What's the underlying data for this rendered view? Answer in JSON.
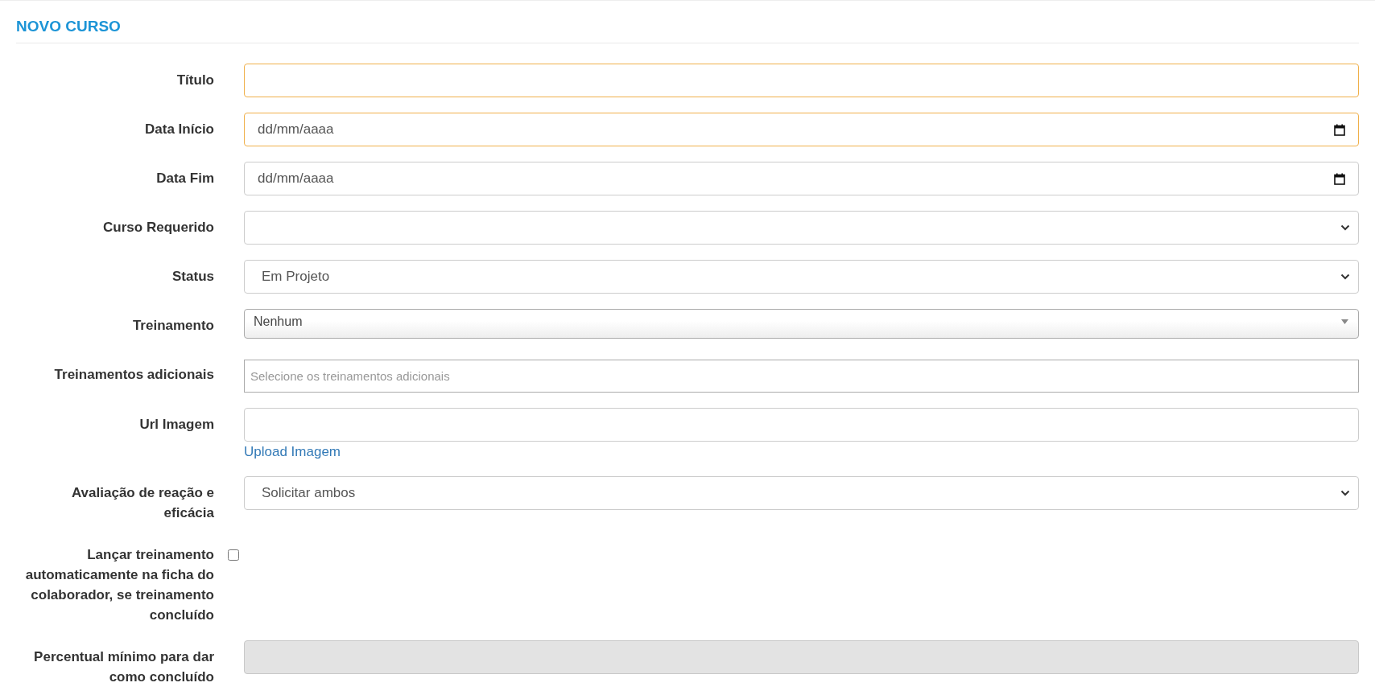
{
  "heading": "NOVO CURSO",
  "fields": [
    {
      "label": "Título",
      "kind": "text",
      "highlighted": true,
      "disabled": false
    },
    {
      "label": "Data Início",
      "kind": "date",
      "placeholder": "dd/mm/aaaa",
      "highlighted": true,
      "disabled": false
    },
    {
      "label": "Data Fim",
      "kind": "date",
      "placeholder": "dd/mm/aaaa",
      "highlighted": false,
      "disabled": false
    },
    {
      "label": "Curso Requerido",
      "kind": "select",
      "highlighted": false,
      "disabled": false
    },
    {
      "label": "Status",
      "kind": "select",
      "value": "Em Projeto",
      "highlighted": false,
      "disabled": false
    },
    {
      "label": "Treinamento",
      "kind": "combo",
      "value": "Nenhum",
      "highlighted": false,
      "disabled": false
    },
    {
      "label": "Treinamentos adicionais",
      "kind": "multi",
      "placeholder": "Selecione os treinamentos adicionais",
      "highlighted": false,
      "disabled": false
    },
    {
      "label": "Url Imagem",
      "kind": "text",
      "link": "Upload Imagem",
      "highlighted": false,
      "disabled": false
    },
    {
      "label": "Avaliação de reação e eficácia",
      "kind": "select",
      "value": "Solicitar ambos",
      "highlighted": false,
      "disabled": false
    },
    {
      "label": "Lançar treinamento automaticamente na ficha do colaborador, se treinamento concluído",
      "kind": "checkbox",
      "checked": false,
      "highlighted": false,
      "disabled": false
    },
    {
      "label": "Percentual mínimo para dar como concluído",
      "kind": "text",
      "highlighted": false,
      "disabled": true
    }
  ]
}
